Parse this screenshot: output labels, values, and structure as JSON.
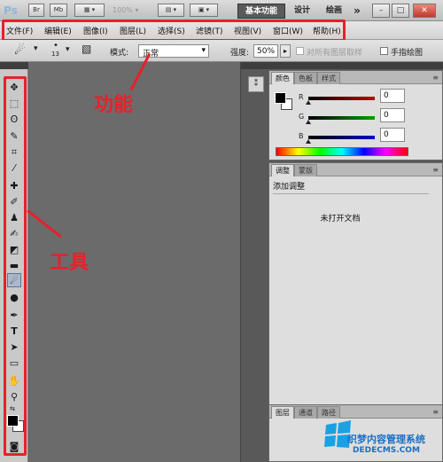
{
  "appbar": {
    "logo": "Ps",
    "icon_br": "Br",
    "icon_mb": "Mb",
    "zoom": "100%",
    "workspaces": [
      "基本功能",
      "设计",
      "绘画"
    ],
    "more": "»"
  },
  "menu": {
    "items": [
      "文件(F)",
      "编辑(E)",
      "图像(I)",
      "图层(L)",
      "选择(S)",
      "滤镜(T)",
      "视图(V)",
      "窗口(W)",
      "帮助(H)"
    ]
  },
  "options": {
    "brush_size": "13",
    "mode_label": "模式:",
    "mode_value": "正常",
    "strength_label": "强度:",
    "strength_value": "50%",
    "sample_all_layers": "对所有图层取样",
    "finger_painting": "手指绘图"
  },
  "color_panel": {
    "tabs": [
      "颜色",
      "色板",
      "样式"
    ],
    "r_label": "R",
    "g_label": "G",
    "b_label": "B",
    "r_value": "0",
    "g_value": "0",
    "b_value": "0"
  },
  "adjust_panel": {
    "tabs": [
      "调整",
      "蒙版"
    ],
    "title": "添加调整",
    "empty_message": "未打开文档"
  },
  "layers_panel": {
    "tabs": [
      "图层",
      "通道",
      "路径"
    ]
  },
  "annotations": {
    "function": "功能",
    "tools": "工具"
  },
  "watermark": {
    "line1": "织梦内容管理系统",
    "line2": "DEDECMS.COM"
  },
  "colors": {
    "highlight": "#e8202a",
    "r_slider": "#c00000",
    "g_slider": "#00a000",
    "b_slider": "#0000c8"
  }
}
